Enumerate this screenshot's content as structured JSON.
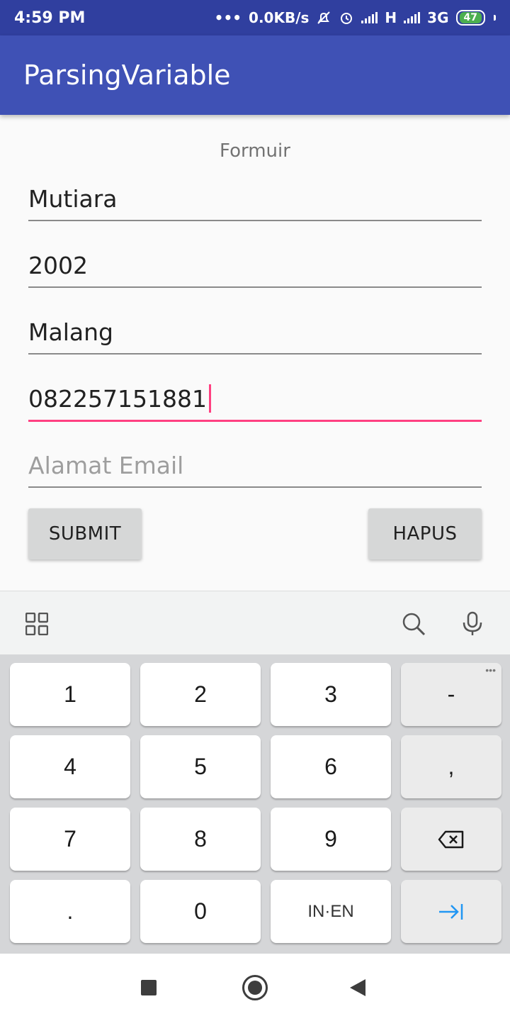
{
  "status_bar": {
    "time": "4:59 PM",
    "dots": "•••",
    "net_speed": "0.0KB/s",
    "net_type_1": "H",
    "net_type_2": "3G",
    "battery": "47"
  },
  "app_bar": {
    "title": "ParsingVariable"
  },
  "form": {
    "label": "Formuir",
    "fields": [
      {
        "value": "Mutiara"
      },
      {
        "value": "2002"
      },
      {
        "value": "Malang"
      },
      {
        "value": "082257151881"
      },
      {
        "placeholder": "Alamat Email"
      }
    ],
    "submit_label": "SUBMIT",
    "clear_label": "HAPUS"
  },
  "keyboard": {
    "toolbar_icons": [
      "grid-icon",
      "search-icon",
      "microphone-icon"
    ],
    "keys": {
      "k1": "1",
      "k2": "2",
      "k3": "3",
      "minus": "-",
      "k4": "4",
      "k5": "5",
      "k6": "6",
      "comma": ",",
      "k7": "7",
      "k8": "8",
      "k9": "9",
      "dot": ".",
      "k0": "0",
      "lang": "IN·EN"
    },
    "accent": "#2196f3"
  },
  "colors": {
    "app_bar": "#3f51b5",
    "status_bar": "#303f9f",
    "accent": "#ff4081"
  }
}
